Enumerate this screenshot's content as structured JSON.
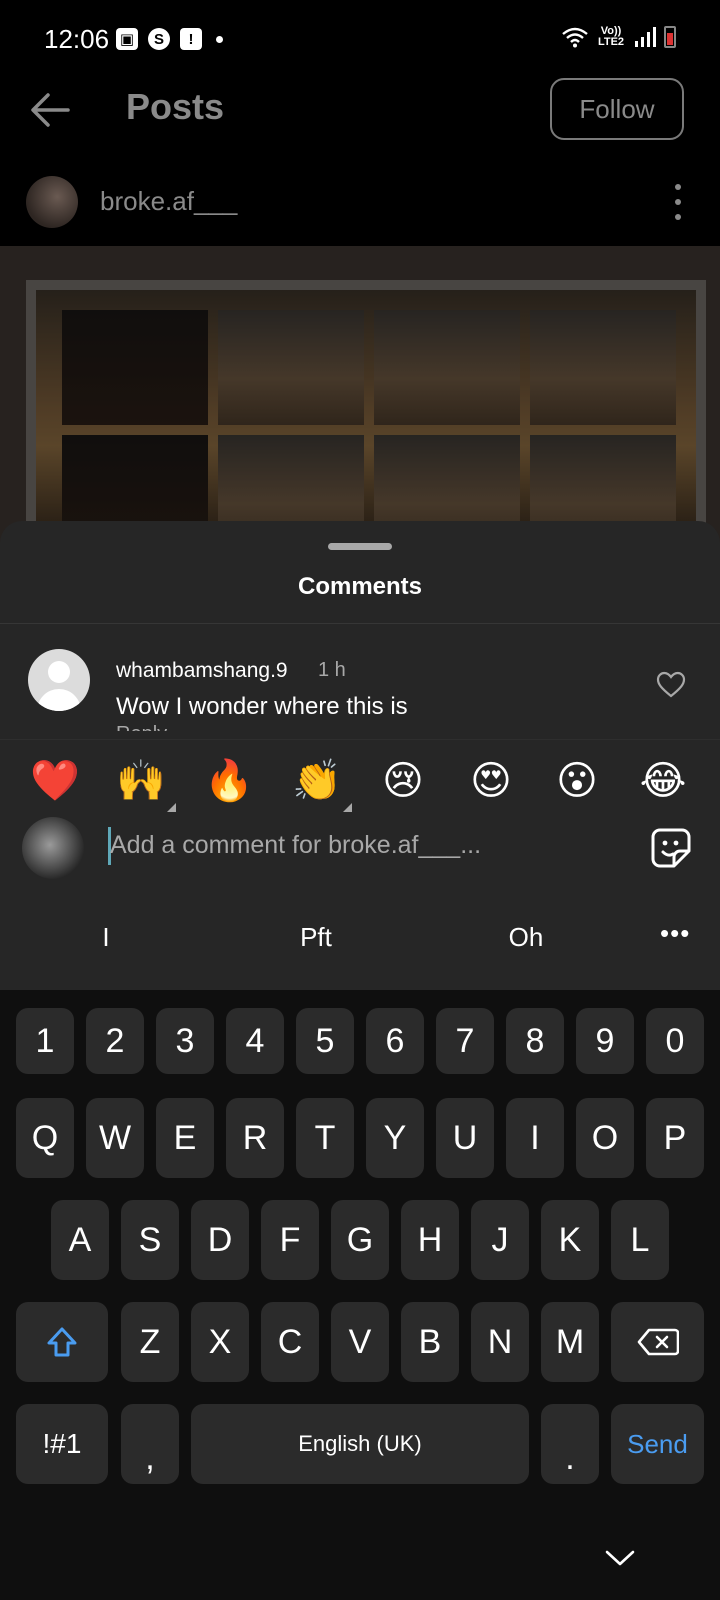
{
  "status_bar": {
    "time": "12:06",
    "network_label": "Vo)) LTE2"
  },
  "header": {
    "title": "Posts",
    "follow_label": "Follow"
  },
  "post": {
    "author": "broke.af___"
  },
  "comments_sheet": {
    "title": "Comments",
    "comments": [
      {
        "user": "whambamshang.9",
        "time": "1 h",
        "text": "Wow I wonder where this is",
        "reply_label": "Reply"
      }
    ],
    "reactions": [
      "❤️",
      "🙌",
      "🔥",
      "👏",
      "😢",
      "😍",
      "😮",
      "😂"
    ],
    "input_placeholder": "Add a comment for broke.af___..."
  },
  "keyboard": {
    "suggestions": [
      "I",
      "Pft",
      "Oh"
    ],
    "suggestions_more": "•••",
    "number_row": [
      "1",
      "2",
      "3",
      "4",
      "5",
      "6",
      "7",
      "8",
      "9",
      "0"
    ],
    "row1": [
      "Q",
      "W",
      "E",
      "R",
      "T",
      "Y",
      "U",
      "I",
      "O",
      "P"
    ],
    "row2": [
      "A",
      "S",
      "D",
      "F",
      "G",
      "H",
      "J",
      "K",
      "L"
    ],
    "row3": [
      "Z",
      "X",
      "C",
      "V",
      "B",
      "N",
      "M"
    ],
    "symbols_label": "!#1",
    "comma_label": ",",
    "space_label": "English (UK)",
    "period_label": ".",
    "send_label": "Send",
    "accent_color": "#4a9cf0"
  }
}
